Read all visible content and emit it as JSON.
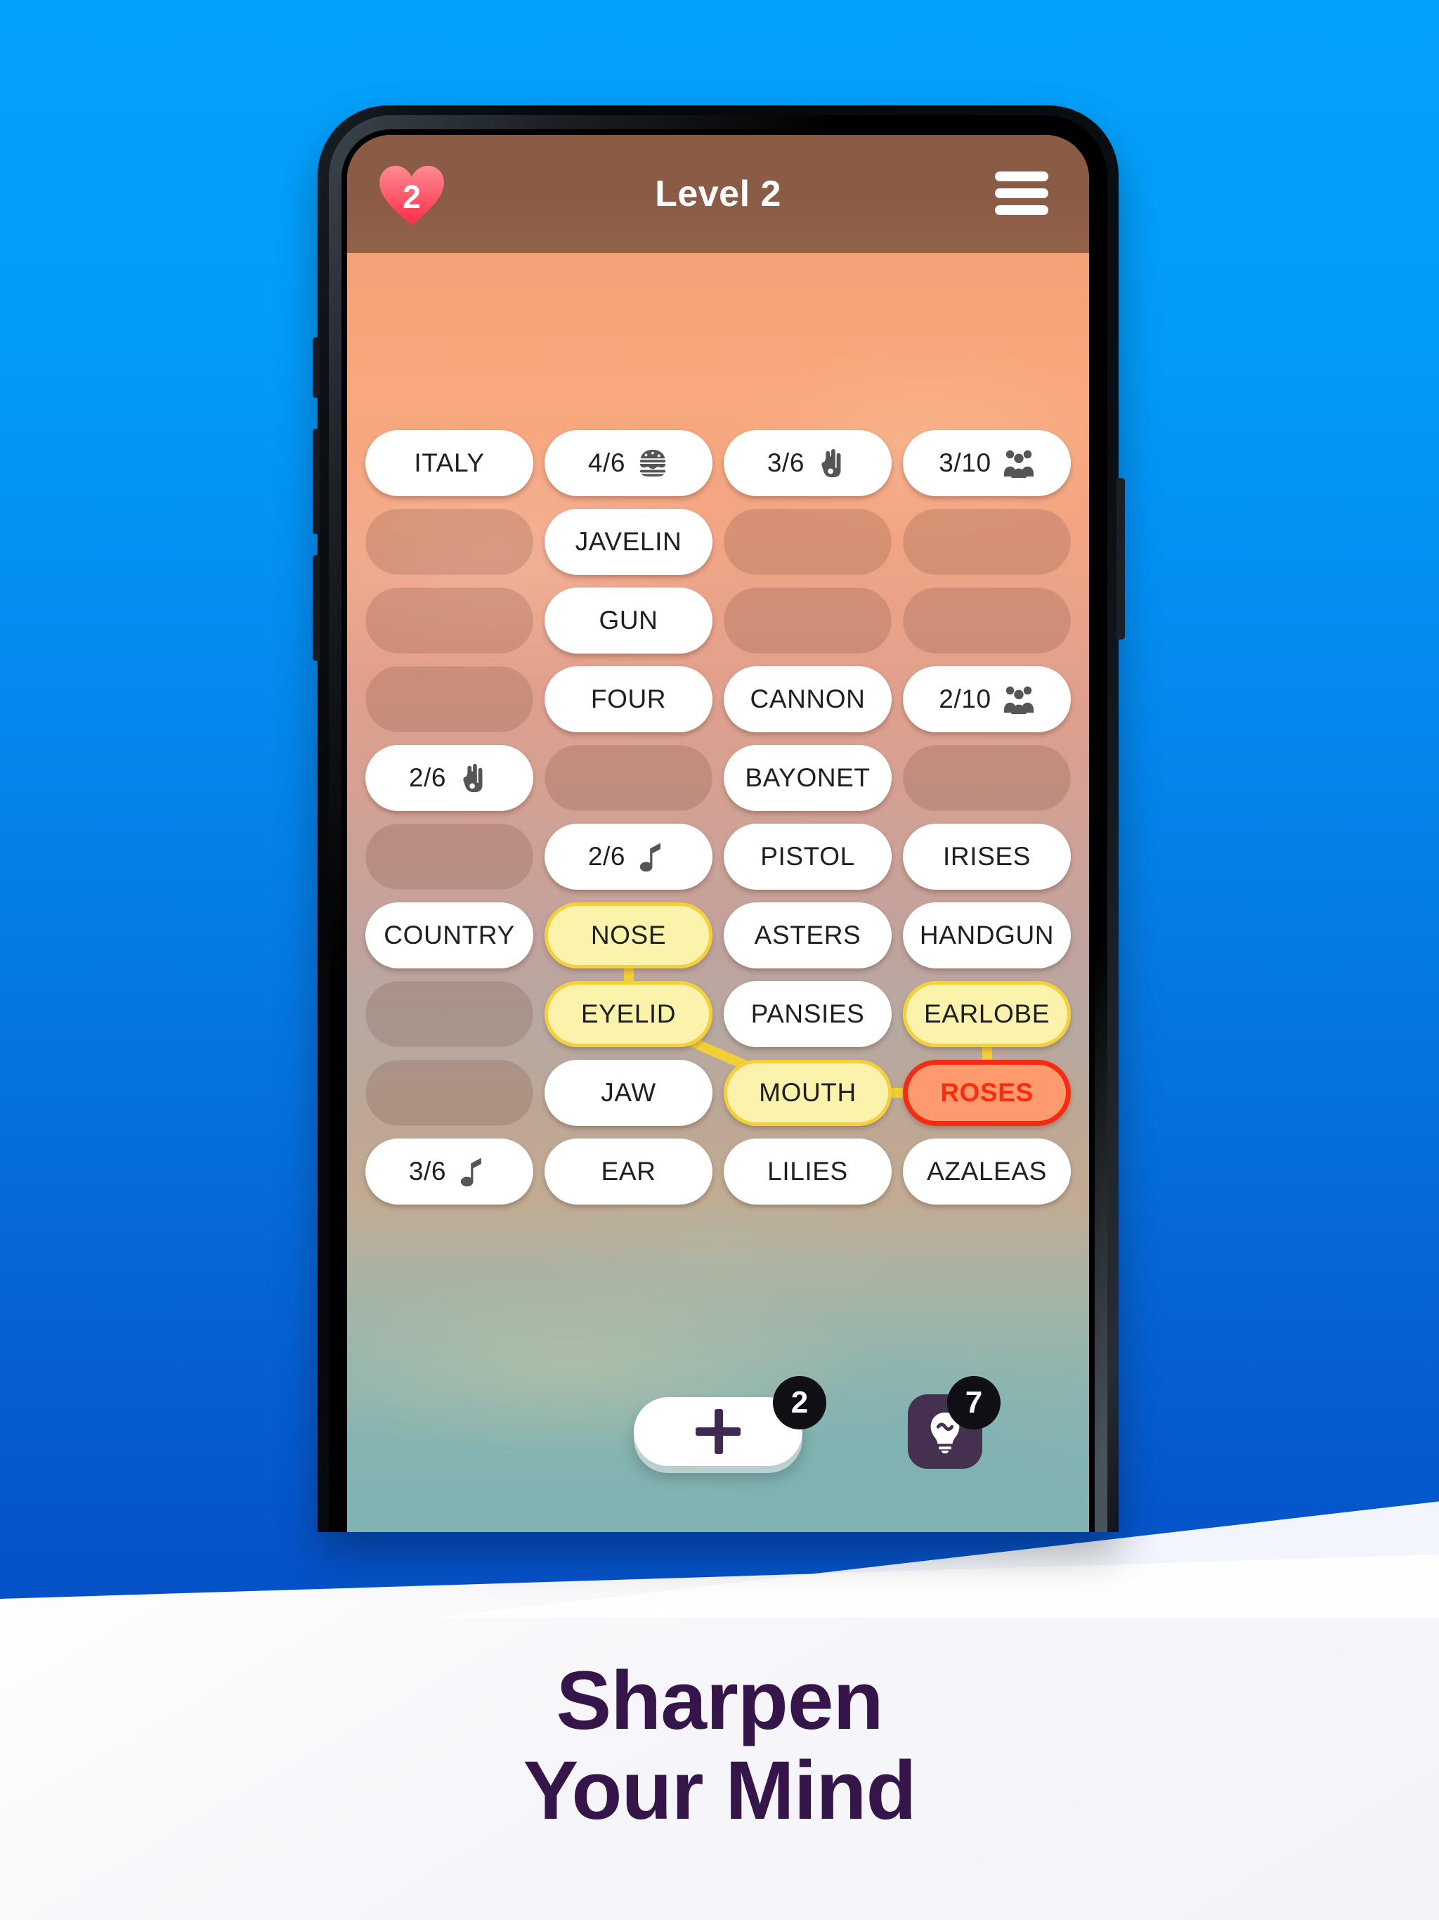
{
  "promo": {
    "tagline_line1": "Sharpen",
    "tagline_line2": "Your Mind",
    "bg_top_color": "#03A2FC",
    "bg_bottom_color": "#0344BD",
    "tagline_color": "#36164A"
  },
  "app": {
    "header": {
      "title": "Level 2",
      "lives": "2",
      "heart_color": "#FF4B5C",
      "header_color": "#8A5B45",
      "menu_icon": "hamburger-menu-icon"
    },
    "grid": {
      "columns": 4,
      "rows": [
        [
          {
            "type": "word",
            "label": "ITALY"
          },
          {
            "type": "counter",
            "label": "4/6",
            "icon": "burger-icon"
          },
          {
            "type": "counter",
            "label": "3/6",
            "icon": "hand-three-fingers-icon"
          },
          {
            "type": "counter",
            "label": "3/10",
            "icon": "people-group-icon"
          }
        ],
        [
          {
            "type": "blank",
            "label": ""
          },
          {
            "type": "word",
            "label": "JAVELIN"
          },
          {
            "type": "blank",
            "label": ""
          },
          {
            "type": "blank",
            "label": ""
          }
        ],
        [
          {
            "type": "blank",
            "label": ""
          },
          {
            "type": "word",
            "label": "GUN"
          },
          {
            "type": "blank",
            "label": ""
          },
          {
            "type": "blank",
            "label": ""
          }
        ],
        [
          {
            "type": "blank",
            "label": ""
          },
          {
            "type": "word",
            "label": "FOUR"
          },
          {
            "type": "word",
            "label": "CANNON"
          },
          {
            "type": "counter",
            "label": "2/10",
            "icon": "people-group-icon"
          }
        ],
        [
          {
            "type": "counter",
            "label": "2/6",
            "icon": "hand-three-fingers-icon"
          },
          {
            "type": "blank",
            "label": ""
          },
          {
            "type": "word",
            "label": "BAYONET"
          },
          {
            "type": "blank",
            "label": ""
          }
        ],
        [
          {
            "type": "blank",
            "label": ""
          },
          {
            "type": "counter",
            "label": "2/6",
            "icon": "music-note-icon"
          },
          {
            "type": "word",
            "label": "PISTOL"
          },
          {
            "type": "word",
            "label": "IRISES"
          }
        ],
        [
          {
            "type": "word",
            "label": "COUNTRY"
          },
          {
            "type": "selected",
            "label": "NOSE"
          },
          {
            "type": "word",
            "label": "ASTERS"
          },
          {
            "type": "word",
            "label": "HANDGUN"
          }
        ],
        [
          {
            "type": "blank",
            "label": ""
          },
          {
            "type": "selected",
            "label": "EYELID"
          },
          {
            "type": "word",
            "label": "PANSIES"
          },
          {
            "type": "selected",
            "label": "EARLOBE"
          }
        ],
        [
          {
            "type": "blank",
            "label": ""
          },
          {
            "type": "word",
            "label": "JAW"
          },
          {
            "type": "selected",
            "label": "MOUTH"
          },
          {
            "type": "wrong",
            "label": "ROSES"
          }
        ],
        [
          {
            "type": "counter",
            "label": "3/6",
            "icon": "music-note-icon"
          },
          {
            "type": "word",
            "label": "EAR"
          },
          {
            "type": "word",
            "label": "LILIES"
          },
          {
            "type": "word",
            "label": "AZALEAS"
          }
        ]
      ]
    },
    "bottom": {
      "add_icon": "plus-icon",
      "add_badge": "2",
      "hint_icon": "lightbulb-icon",
      "hint_badge": "7",
      "hint_button_color": "#46304F"
    }
  }
}
